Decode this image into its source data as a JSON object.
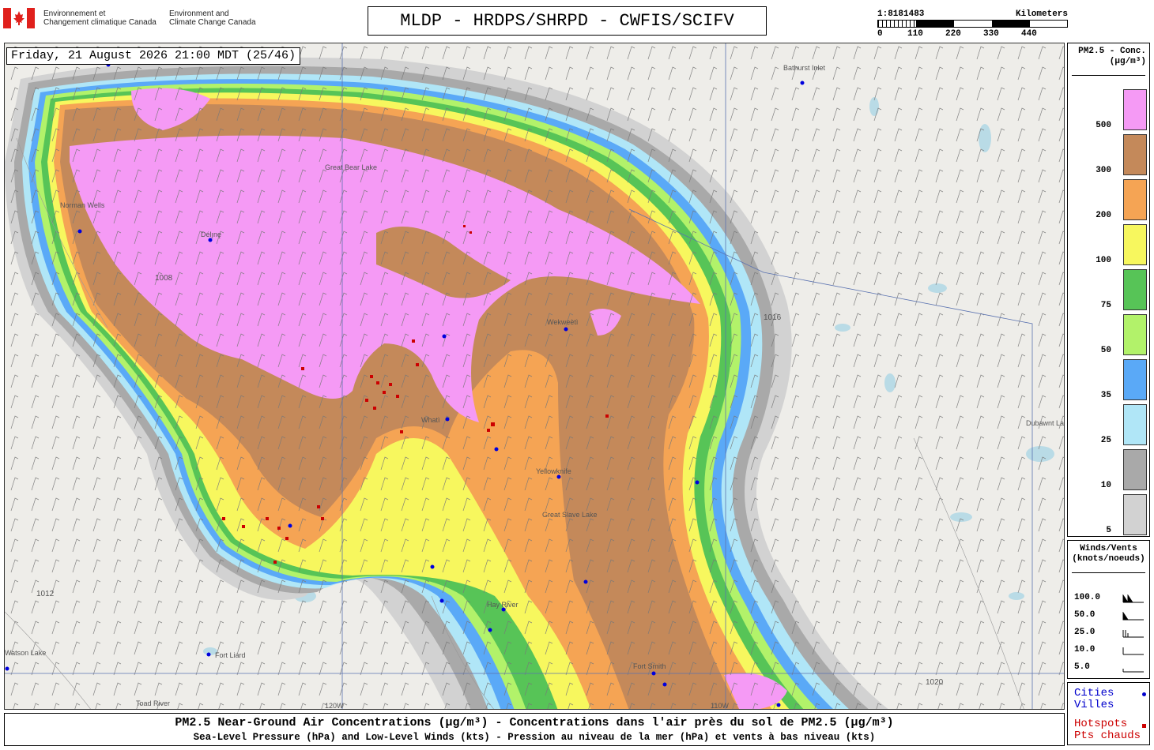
{
  "header": {
    "gov_fr_line1": "Environnement et",
    "gov_fr_line2": "Changement climatique Canada",
    "gov_en_line1": "Environment and",
    "gov_en_line2": "Climate Change Canada",
    "title": "MLDP - HRDPS/SHRPD - CWFIS/SCIFV",
    "scale_ratio": "1:8181483",
    "scale_unit": "Kilometers",
    "scale_ticks": [
      "0",
      "110",
      "220",
      "330",
      "440"
    ]
  },
  "map": {
    "timestamp": "Friday, 21 August 2026 21:00 MDT (25/46)",
    "places": [
      {
        "name": "Bathurst Inlet"
      },
      {
        "name": "Norman Wells"
      },
      {
        "name": "Délı̨nę"
      },
      {
        "name": "Great Bear Lake"
      },
      {
        "name": "Wekweètì"
      },
      {
        "name": "Whatì"
      },
      {
        "name": "Yellowknife"
      },
      {
        "name": "Great Slave Lake"
      },
      {
        "name": "Hay River"
      },
      {
        "name": "Fort Liard"
      },
      {
        "name": "Fort Smith"
      },
      {
        "name": "Toad River"
      },
      {
        "name": "Dubawnt Lake"
      },
      {
        "name": "Watson Lake"
      }
    ],
    "longitude_labels": [
      "120W",
      "110W"
    ],
    "isobars": [
      "1008",
      "1012",
      "1016",
      "1020"
    ]
  },
  "legend": {
    "title_line1": "PM2.5 - Conc.",
    "title_line2": "(µg/m³)",
    "bins": [
      {
        "label": "500",
        "color": "#f59af5"
      },
      {
        "label": "300",
        "color": "#c4895a"
      },
      {
        "label": "200",
        "color": "#f5a454"
      },
      {
        "label": "100",
        "color": "#f7f75e"
      },
      {
        "label": "75",
        "color": "#57c457"
      },
      {
        "label": "50",
        "color": "#b2f26a"
      },
      {
        "label": "35",
        "color": "#5aa9f7"
      },
      {
        "label": "25",
        "color": "#b0e6f7"
      },
      {
        "label": "10",
        "color": "#a9a9a9"
      },
      {
        "label": "5",
        "color": "#d2d2d2"
      }
    ]
  },
  "winds": {
    "title_line1": "Winds/Vents",
    "title_line2": "(knots/noeuds)",
    "rows": [
      "100.0",
      "50.0",
      "25.0",
      "10.0",
      "5.0"
    ]
  },
  "symbols": {
    "cities_en": "Cities",
    "cities_fr": "Villes",
    "cities_color": "#0000cc",
    "hotspots_en": "Hotspots",
    "hotspots_fr": "Pts chauds",
    "hotspots_color": "#cc0000"
  },
  "footer": {
    "title": "PM2.5 Near-Ground Air Concentrations (µg/m³) - Concentrations dans l'air près du sol de PM2.5 (µg/m³)",
    "subtitle": "Sea-Level Pressure (hPa) and Low-Level Winds (kts) - Pression au niveau de la mer (hPa) et vents à bas niveau (kts)"
  }
}
